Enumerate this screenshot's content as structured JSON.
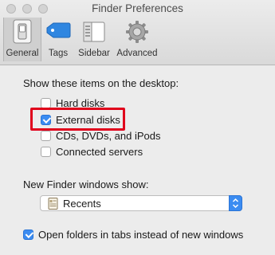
{
  "window": {
    "title": "Finder Preferences"
  },
  "toolbar": {
    "tabs": [
      {
        "label": "General",
        "icon": "general-switch-icon",
        "selected": true
      },
      {
        "label": "Tags",
        "icon": "tag-icon",
        "selected": false
      },
      {
        "label": "Sidebar",
        "icon": "sidebar-icon",
        "selected": false
      },
      {
        "label": "Advanced",
        "icon": "gear-icon",
        "selected": false
      }
    ]
  },
  "desktop": {
    "heading": "Show these items on the desktop:",
    "items": [
      {
        "label": "Hard disks",
        "checked": false
      },
      {
        "label": "External disks",
        "checked": true,
        "highlighted": true
      },
      {
        "label": "CDs, DVDs, and iPods",
        "checked": false
      },
      {
        "label": "Connected servers",
        "checked": false
      }
    ]
  },
  "new_windows": {
    "heading": "New Finder windows show:",
    "selected": "Recents",
    "icon": "document-icon"
  },
  "tabs_option": {
    "label": "Open folders in tabs instead of new windows",
    "checked": true
  },
  "colors": {
    "accent": "#3b8cf1",
    "highlight_box": "#e0001b",
    "window_bg": "#ececec"
  }
}
